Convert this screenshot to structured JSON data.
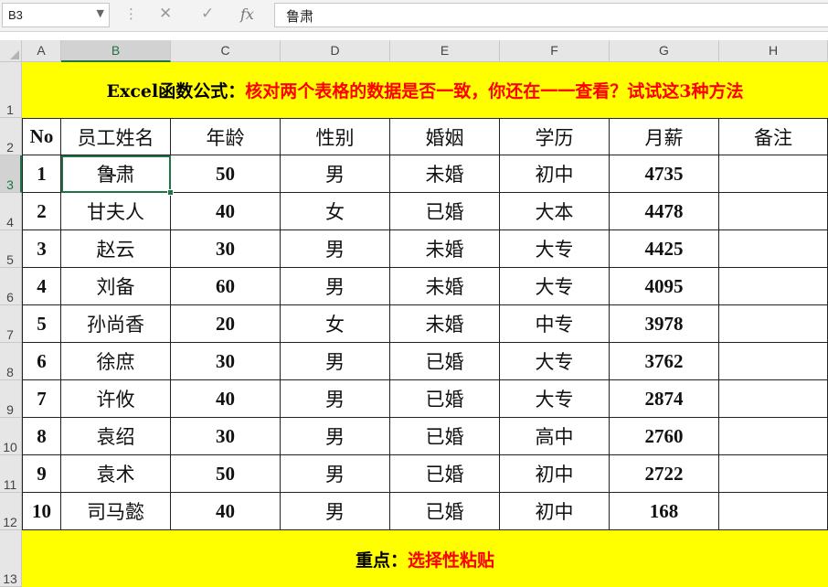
{
  "formula_bar": {
    "name_box": "B3",
    "name_box_arrow": "▼",
    "dots": "⋮",
    "cancel_icon": "✕",
    "enter_icon": "✓",
    "fx_label": "fx",
    "content": "鲁肃"
  },
  "columns": [
    "A",
    "B",
    "C",
    "D",
    "E",
    "F",
    "G",
    "H"
  ],
  "rows": [
    "1",
    "2",
    "3",
    "4",
    "5",
    "6",
    "7",
    "8",
    "9",
    "10",
    "11",
    "12",
    "13"
  ],
  "title": {
    "prefix": "Excel函数公式：",
    "main": "核对两个表格的数据是否一致，你还在一一查看？试试这3种方法"
  },
  "table": {
    "headers": [
      "No",
      "员工姓名",
      "年龄",
      "性别",
      "婚姻",
      "学历",
      "月薪",
      "备注"
    ],
    "rows": [
      [
        "1",
        "鲁肃",
        "50",
        "男",
        "未婚",
        "初中",
        "4735",
        ""
      ],
      [
        "2",
        "甘夫人",
        "40",
        "女",
        "已婚",
        "大本",
        "4478",
        ""
      ],
      [
        "3",
        "赵云",
        "30",
        "男",
        "未婚",
        "大专",
        "4425",
        ""
      ],
      [
        "4",
        "刘备",
        "60",
        "男",
        "未婚",
        "大专",
        "4095",
        ""
      ],
      [
        "5",
        "孙尚香",
        "20",
        "女",
        "未婚",
        "中专",
        "3978",
        ""
      ],
      [
        "6",
        "徐庶",
        "30",
        "男",
        "已婚",
        "大专",
        "3762",
        ""
      ],
      [
        "7",
        "许攸",
        "40",
        "男",
        "已婚",
        "大专",
        "2874",
        ""
      ],
      [
        "8",
        "袁绍",
        "30",
        "男",
        "已婚",
        "高中",
        "2760",
        ""
      ],
      [
        "9",
        "袁术",
        "50",
        "男",
        "已婚",
        "初中",
        "2722",
        ""
      ],
      [
        "10",
        "司马懿",
        "40",
        "男",
        "已婚",
        "初中",
        "168",
        ""
      ]
    ]
  },
  "footer": {
    "prefix": "重点：",
    "main": "选择性粘贴"
  },
  "colors": {
    "accent": "#217346",
    "highlight": "#ffff00",
    "red_text": "#ff0000"
  }
}
